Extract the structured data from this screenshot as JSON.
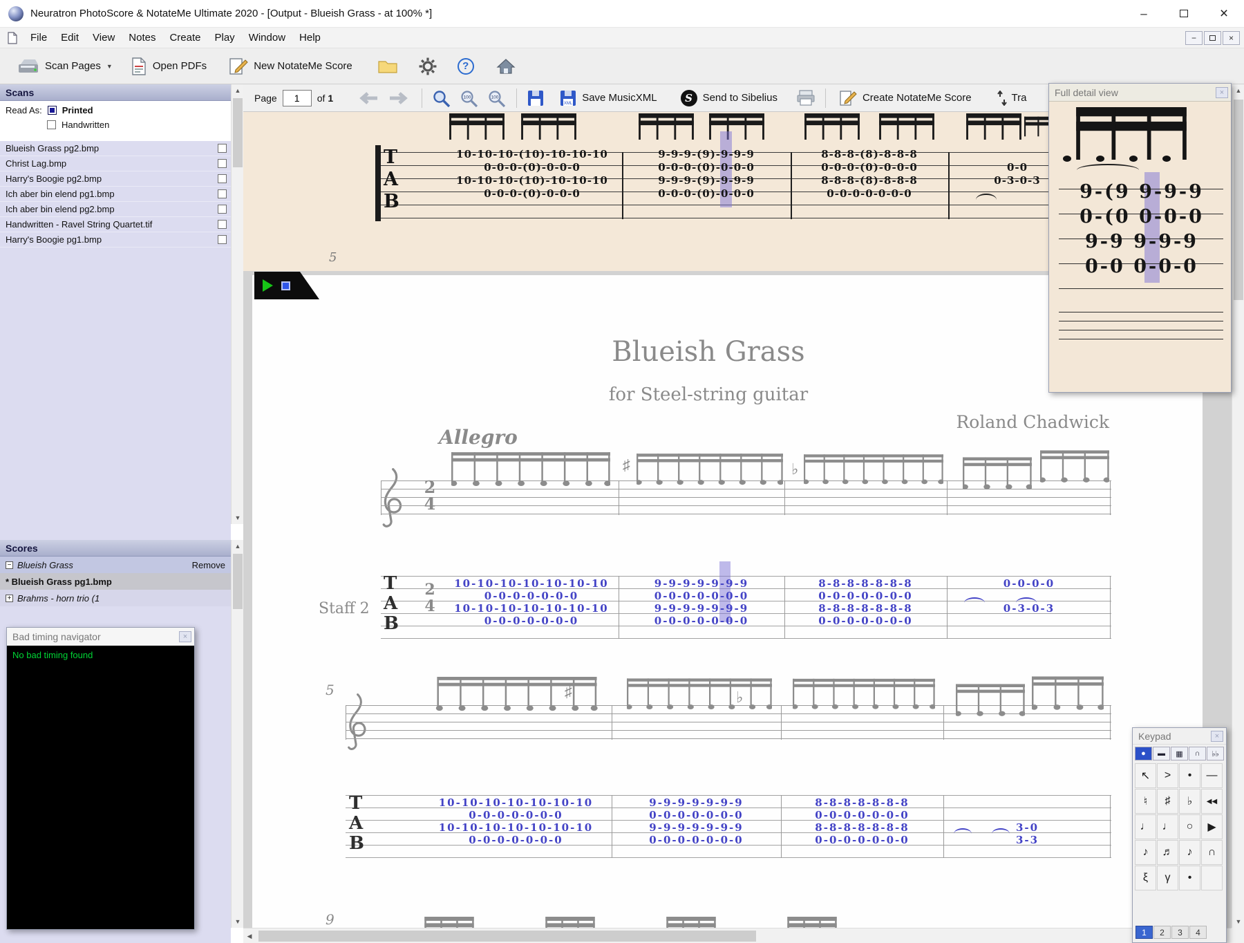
{
  "window": {
    "title": "Neuratron PhotoScore & NotateMe Ultimate 2020 - [Output - Blueish Grass - at 100% *]"
  },
  "menu": {
    "items": [
      "File",
      "Edit",
      "View",
      "Notes",
      "Create",
      "Play",
      "Window",
      "Help"
    ]
  },
  "toolbar": {
    "scan_pages": "Scan Pages",
    "open_pdfs": "Open PDFs",
    "new_notateme": "New NotateMe Score"
  },
  "icons": {
    "dropdown": "▼",
    "scroll_up": "▲",
    "scroll_down": "▼",
    "scroll_left": "◀",
    "scroll_right": "▶",
    "close": "×",
    "minimize": "–",
    "question": "?",
    "collapse": "−",
    "expand": "+"
  },
  "scans": {
    "title": "Scans",
    "read_as": "Read As:",
    "printed": "Printed",
    "handwritten": "Handwritten",
    "files": [
      "Blueish Grass pg2.bmp",
      "Christ Lag.bmp",
      "Harry's Boogie pg2.bmp",
      "Ich aber bin elend pg1.bmp",
      "Ich aber bin elend pg2.bmp",
      "Handwritten - Ravel String Quartet.tif",
      "Harry's Boogie pg1.bmp"
    ]
  },
  "scores": {
    "title": "Scores",
    "remove": "Remove",
    "rows": [
      "Blueish Grass",
      "* Blueish Grass pg1.bmp",
      "Brahms - horn trio (1"
    ]
  },
  "bad_timing": {
    "title": "Bad timing navigator",
    "message": "No bad timing found"
  },
  "page_toolbar": {
    "page": "Page",
    "value": "1",
    "of": "of",
    "total": "1",
    "save_musicxml": "Save MusicXML",
    "send_sibelius": "Send to Sibelius",
    "create_notateme": "Create NotateMe Score",
    "transpose": "Tra"
  },
  "detail": {
    "title": "Full detail view",
    "rows": [
      "9-(9 9-9-9",
      "0-(0 0-0-0",
      "9-9 9-9-9",
      "0-0 0-0-0"
    ]
  },
  "keypad": {
    "title": "Keypad",
    "toggles": [
      "●",
      "▬",
      "▦",
      "∩",
      "♭♭"
    ],
    "grid": [
      [
        "↖",
        ">",
        "•",
        "—"
      ],
      [
        "♮",
        "♯",
        "♭",
        "◀◀"
      ],
      [
        "♩",
        "♩",
        "○",
        "▶"
      ],
      [
        "♪",
        "♬",
        "♪",
        "∩"
      ],
      [
        "ξ",
        "γ",
        "•",
        ""
      ]
    ],
    "tabs": [
      "1",
      "2",
      "3",
      "4"
    ]
  },
  "strip": {
    "measure_number": "5",
    "tab_letters": [
      "T",
      "A",
      "B"
    ],
    "rows": [
      [
        "10-10-10-(10)-10-10-10",
        "9-9-9-(9)-9-9-9",
        "8-8-8-(8)-8-8-8",
        ""
      ],
      [
        "0-0-0-(0)-0-0-0",
        "0-0-0-(0)-0-0-0",
        "0-0-0-(0)-0-0-0",
        "0-0"
      ],
      [
        "10-10-10-(10)-10-10-10",
        "9-9-9-(9)-9-9-9",
        "8-8-8-(8)-8-8-8",
        "0-3-0-3"
      ],
      [
        "0-0-0-(0)-0-0-0",
        "0-0-0-(0)-0-0-0",
        "0-0-0-0-0-0-0",
        ""
      ]
    ]
  },
  "score": {
    "title": "Blueish Grass",
    "subtitle": "for Steel-string guitar",
    "composer": "Roland Chadwick",
    "tempo": "Allegro",
    "staff2": "Staff 2",
    "time_upper": "2",
    "time_lower": "4",
    "tab_letters": [
      "T",
      "A",
      "B"
    ],
    "measure5": "5",
    "measure9": "9",
    "sys1": [
      [
        "10-10-10-10-10-10-10",
        "9-9-9-9-9-9-9",
        "8-8-8-8-8-8-8",
        "0-0-0-0"
      ],
      [
        "0-0-0-0-0-0-0",
        "0-0-0-0-0-0-0",
        "0-0-0-0-0-0-0",
        ""
      ],
      [
        "10-10-10-10-10-10-10",
        "9-9-9-9-9-9-9",
        "8-8-8-8-8-8-8",
        "0-3-0-3"
      ],
      [
        "0-0-0-0-0-0-0",
        "0-0-0-0-0-0-0",
        "0-0-0-0-0-0-0",
        ""
      ]
    ],
    "sys2": [
      [
        "10-10-10-10-10-10-10",
        "9-9-9-9-9-9-9",
        "8-8-8-8-8-8-8",
        ""
      ],
      [
        "0-0-0-0-0-0-0",
        "0-0-0-0-0-0-0",
        "0-0-0-0-0-0-0",
        ""
      ],
      [
        "10-10-10-10-10-10-10",
        "9-9-9-9-9-9-9",
        "8-8-8-8-8-8-8",
        "3-0"
      ],
      [
        "0-0-0-0-0-0-0",
        "0-0-0-0-0-0-0",
        "0-0-0-0-0-0-0",
        "3-3"
      ]
    ]
  }
}
